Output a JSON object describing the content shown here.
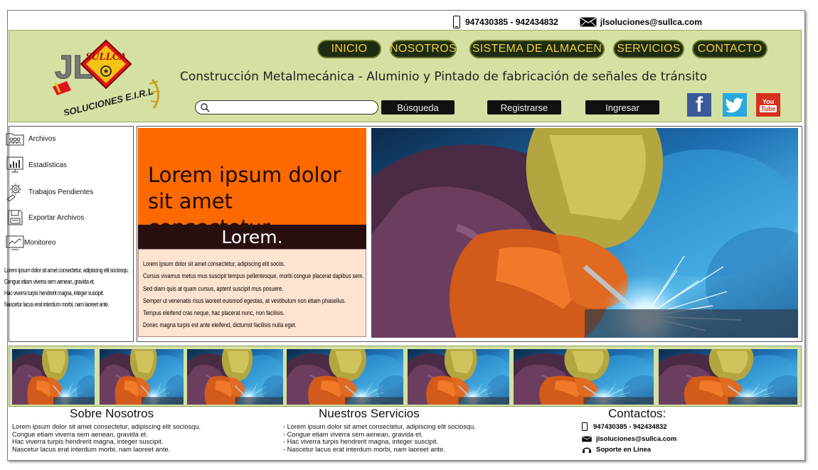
{
  "topbar": {
    "phone": "947430385 - 942434832",
    "email": "jlsoluciones@sullca.com"
  },
  "logo": {
    "brand": "SULLCA",
    "letters": "JL",
    "sub": "SOLUCIONES E.I.R.L"
  },
  "nav": [
    "INICIO",
    "NOSOTROS",
    "SISTEMA DE ALMACEN",
    "SERVICIOS",
    "CONTACTO"
  ],
  "tagline": "Construcción Metalmecánica - Aluminio y Pintado de fabricación de señales de tránsito",
  "search": {
    "placeholder": ""
  },
  "buttons": {
    "search": "Búsqueda",
    "register": "Registrarse",
    "login": "Ingresar"
  },
  "social": {
    "facebook": "f",
    "youtube_top": "You",
    "youtube_bottom": "Tube"
  },
  "sidebar": {
    "items": [
      "Archivos",
      "Estadísticas",
      "Trabajos Pendientes",
      "Exportar Archivos",
      "Monitoreo"
    ],
    "text": [
      "Lorem ipsum dolor sit amet consectetur, adipiscing elit sociosqu.",
      "Congue etiam viverra sem aenean, gravida et.",
      "Hac viverra turpis hendrerit magna, integer suscipit.",
      "Nascetur lacus erat interdum morbi, nam laoreet ante."
    ]
  },
  "feature": {
    "title": "Lorem ipsum dolor sit amet consectetur",
    "subtitle": "Lorem.",
    "body": [
      "Lorem ipsum dolor sit amet consectetur, adipiscing elit sociis.",
      "Cursus vivamus metus mus suscipit tempus pellentesque, morbi congue placerat dapibus sem.",
      "Sed diam quis at quam cursus, aptent suscipit mus posuere.",
      "Semper ut venenatis risus laoreet euismod egestas, at vestibulum non etiam phasellus.",
      "Tempus eleifend cras neque, hac placerat nunc, non facilisis.",
      "Donec magna turpis est ante eleifend, dictumst facilisis nulla eget."
    ]
  },
  "footer": {
    "about": {
      "title": "Sobre Nosotros",
      "lines": [
        "Lorem ipsum dolor sit amet consectetur, adipiscing elit sociosqu.",
        "Congue etiam viverra sem aenean, gravida et.",
        "Hac viverra turpis hendrerit magna, integer suscipit.",
        "Nascetur lacus erat interdum morbi, nam laoreet ante."
      ]
    },
    "services": {
      "title": "Nuestros Servicios",
      "lines": [
        "- Lorem ipsum dolor sit amet consectetur, adipiscing elit sociosqu.",
        "- Congue etiam viverra sem aenean, gravida et.",
        "- Hac viverra turpis hendrerit magna, integer suscipit.",
        "- Nascetur lacus erat interdum morbi, nam laoreet ante."
      ]
    },
    "contacts": {
      "title": "Contactos:",
      "phone": "947430385 - 942434832",
      "email": "jlsoluciones@sullca.com",
      "support": "Soporte en Línea"
    }
  },
  "colors": {
    "header": "#d4e1a3",
    "nav_bg": "#1d2c12",
    "nav_text": "#f1ce3c",
    "orange": "#ff6a00",
    "dark_band": "#2a0f10",
    "peach": "#fde3d0"
  }
}
